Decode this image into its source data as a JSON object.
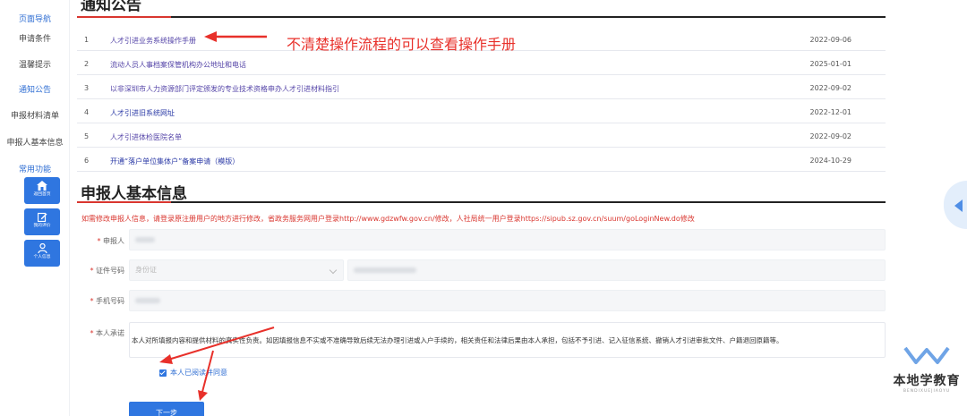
{
  "sidebar": {
    "nav_heading": "页面导航",
    "items": [
      {
        "label": "申请条件",
        "active": false
      },
      {
        "label": "温馨提示",
        "active": false
      },
      {
        "label": "通知公告",
        "active": true
      },
      {
        "label": "申报材料清单",
        "active": false
      },
      {
        "label": "申报人基本信息",
        "active": false
      }
    ],
    "func_heading": "常用功能",
    "buttons": [
      {
        "label": "返回首页",
        "icon": "home-icon"
      },
      {
        "label": "我的评价",
        "icon": "edit-icon"
      },
      {
        "label": "个人信息",
        "icon": "user-icon"
      }
    ]
  },
  "notices": {
    "title": "通知公告",
    "rows": [
      {
        "num": "1",
        "title": "人才引进业务系统操作手册",
        "date": "2022-09-06"
      },
      {
        "num": "2",
        "title": "流动人员人事档案保管机构办公地址和电话",
        "date": "2025-01-01"
      },
      {
        "num": "3",
        "title": "以非深圳市人力资源部门评定颁发的专业技术资格申办人才引进材料指引",
        "date": "2022-09-02"
      },
      {
        "num": "4",
        "title": "人才引进旧系统网址",
        "date": "2022-12-01"
      },
      {
        "num": "5",
        "title": "人才引进体检医院名单",
        "date": "2022-09-02"
      },
      {
        "num": "6",
        "title": "开通“落户单位集体户”备案申请（模版）",
        "date": "2024-10-29"
      }
    ]
  },
  "applicant": {
    "title": "申报人基本信息",
    "tip": "如需修改申报人信息，请登录原注册用户的地方进行修改，省政务服务网用户登录http://www.gdzwfw.gov.cn/修改，人社局统一用户登录https://sipub.sz.gov.cn/suum/goLoginNew.do修改",
    "name_label": "申报人",
    "id_label": "证件号码",
    "id_type": "身份证",
    "phone_label": "手机号码",
    "promise_label": "本人承诺",
    "promise_text": "本人对所填报内容和提供材料的真实性负责。如因填报信息不实或不准确导致后续无法办理引进或入户手续的，相关责任和法律后果由本人承担，包括不予引进、记入征信系统、撤销人才引进审批文件、户籍退回原籍等。",
    "agree_text": "本人已阅读并同意",
    "next_button": "下一步"
  },
  "annotation": {
    "text": "不清楚操作流程的可以查看操作手册",
    "color": "#e8302a"
  },
  "watermark": {
    "name": "本地学教育",
    "sub": "BENDIXUEJIAOYU"
  },
  "colors": {
    "primary": "#2f76e0",
    "accent_red": "#d9362f",
    "link": "#5545a8"
  }
}
